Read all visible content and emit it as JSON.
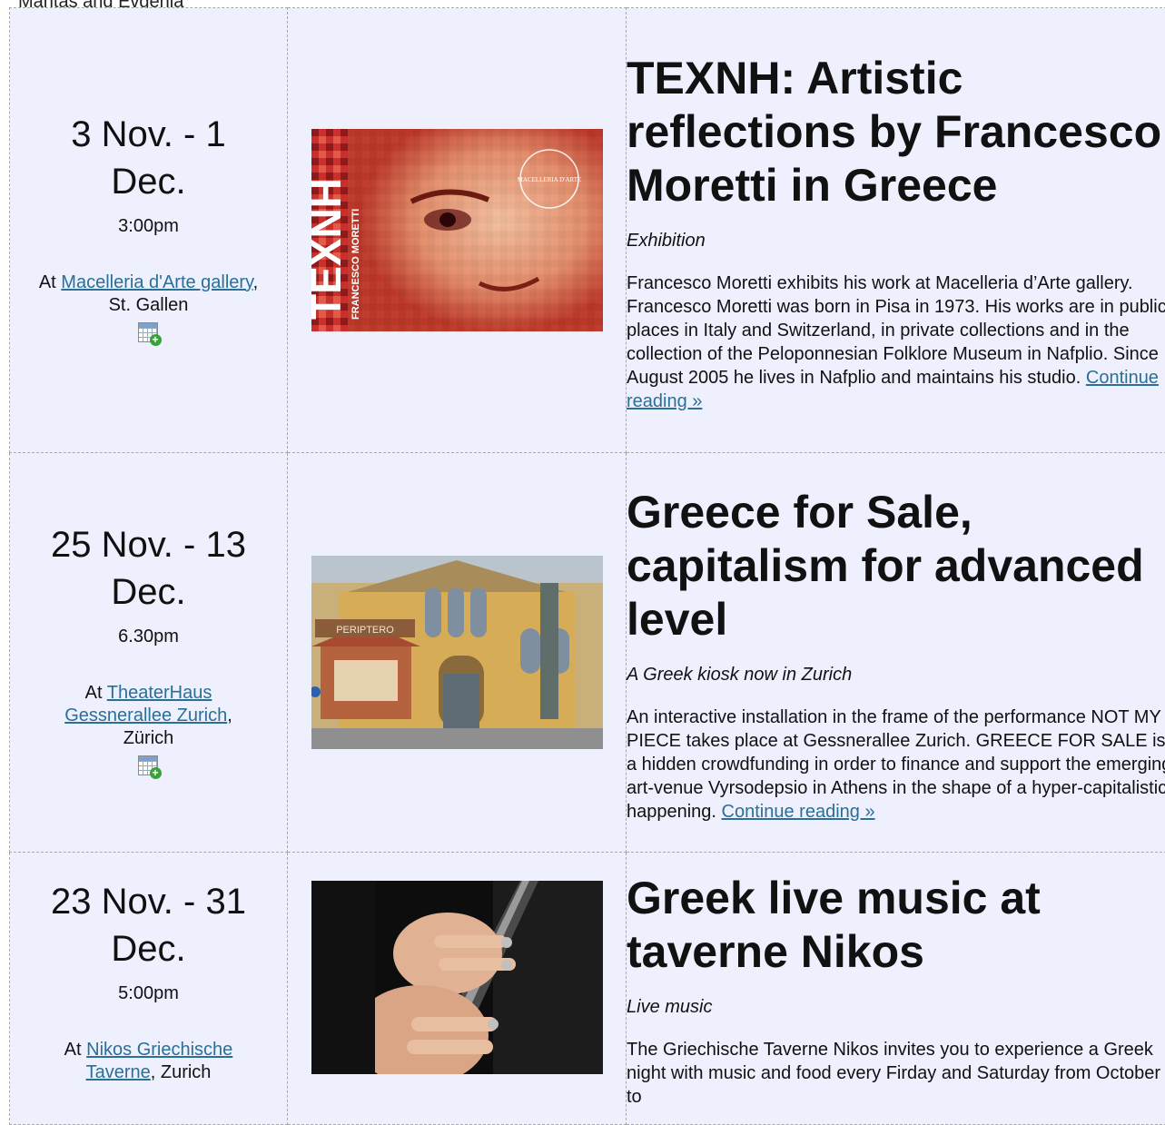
{
  "top_text": "Mantas and Evgenia",
  "calendar_icon": "calendar-add-icon",
  "events": [
    {
      "date_range": "3 Nov. - 1 Dec.",
      "time": "3:00pm",
      "at_prefix": "At",
      "venue_link": " Macelleria d'Arte gallery",
      "venue_suffix": ", St. Gallen",
      "image_alt": "TEXNH Francesco Moretti poster",
      "title": "TEXNH: Artistic reflections by Francesco Moretti in Greece",
      "subtitle": "Exhibition",
      "description": "Francesco Moretti exhibits his work at Macelleria d’Arte gallery. Francesco Moretti was born in Pisa in 1973. His works are in public places in Italy and Switzerland, in private collections and in the collection of the Peloponnesian Folklore Museum in Nafplio. Since August 2005 he lives in Nafplio and maintains his studio.",
      "read_more": "Continue reading »",
      "poster_text": "TEXNH",
      "poster_subtext": "FRANCESCO MORETTI",
      "poster_stamp": "MACELLERIA D'ARTE"
    },
    {
      "date_range": "25 Nov. - 13 Dec.",
      "time": "6.30pm",
      "at_prefix": "At",
      "venue_link": "TheaterHaus Gessnerallee Zurich",
      "venue_suffix": ", Zürich",
      "image_alt": "Periptero kiosk in front of TheaterHaus Gessnerallee",
      "title": "Greece for Sale, capitalism for advanced level",
      "subtitle": "A Greek kiosk now in Zurich",
      "description": "An interactive installation in the frame of the performance NOT MY PIECE takes place at Gessnerallee Zurich. GREECE FOR SALE is a hidden crowdfunding in order to finance and support the emerging art-venue Vyrsodepsio in Athens in the shape of a hyper-capitalistic happening.",
      "read_more": "Continue reading »",
      "kiosk_sign": "PERIPTERO"
    },
    {
      "date_range": "23 Nov. - 31 Dec.",
      "time": "5:00pm",
      "at_prefix": "At",
      "venue_link": " Nikos Griechische Taverne",
      "venue_suffix": ", Zurich",
      "image_alt": "Hands playing a clarinet",
      "title": "Greek live music at taverne Nikos",
      "subtitle": "Live music",
      "description": "The Griechische Taverne Nikos invites you to experience a Greek night with music and food every Firday and Saturday from October to",
      "read_more": ""
    }
  ]
}
